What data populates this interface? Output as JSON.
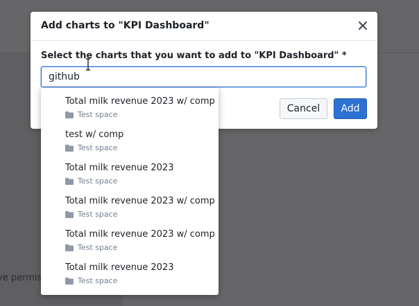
{
  "modal": {
    "title": "Add charts to \"KPI Dashboard\"",
    "field_label": "Select the charts that you want to add to \"KPI Dashboard\" *",
    "search_value": "github",
    "cancel_label": "Cancel",
    "add_label": "Add"
  },
  "background": {
    "partial_text": "ve permiss"
  },
  "dropdown": {
    "options": [
      {
        "title": "Total milk revenue 2023 w/ comp",
        "space": "Test space"
      },
      {
        "title": "test w/ comp",
        "space": "Test space"
      },
      {
        "title": "Total milk revenue 2023",
        "space": "Test space"
      },
      {
        "title": "Total milk revenue 2023 w/ comp",
        "space": "Test space"
      },
      {
        "title": "Total milk revenue 2023 w/ comp",
        "space": "Test space"
      },
      {
        "title": "Total milk revenue 2023",
        "space": "Test space"
      }
    ]
  },
  "colors": {
    "primary": "#2d72d2",
    "overlay": "#5f5f61",
    "muted_text": "#738091"
  },
  "icons": {
    "close": "close-icon",
    "folder": "folder-icon",
    "text_cursor": "text-cursor-icon"
  }
}
